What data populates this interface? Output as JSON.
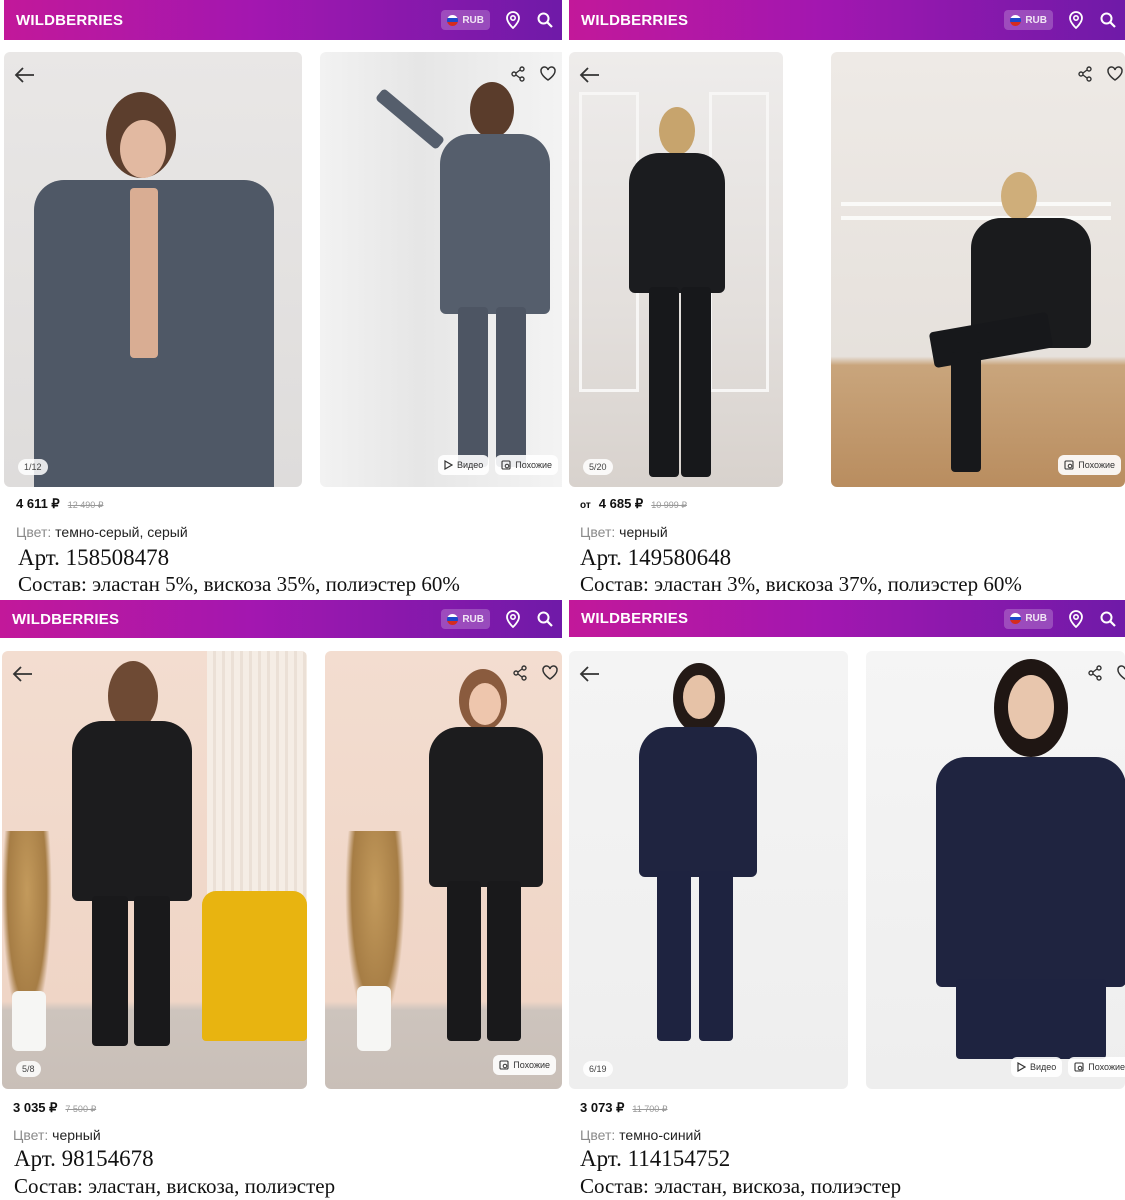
{
  "brand": "WILDBERRIES",
  "currency": "RUB",
  "labels": {
    "video": "Видео",
    "similar": "Похожие",
    "color_label": "Цвет:"
  },
  "colors": {
    "header_start": "#c2189a",
    "header_end": "#6f1aa8"
  },
  "products": [
    {
      "counter": "1/12",
      "price": "4 611 ₽",
      "old_price": "12 490 ₽",
      "price_prefix": "",
      "color": "темно-серый, серый",
      "article": "Арт. 158508478",
      "composition": "Состав: эластан 5%, вискоза 35%, полиэстер 60%",
      "has_video": true
    },
    {
      "counter": "5/20",
      "price": "4 685 ₽",
      "old_price": "10 999 ₽",
      "price_prefix": "от",
      "color": "черный",
      "article": "Арт. 149580648",
      "composition": "Состав: эластан 3%, вискоза 37%, полиэстер 60%",
      "has_video": false
    },
    {
      "counter": "5/8",
      "price": "3 035 ₽",
      "old_price": "7 500 ₽",
      "price_prefix": "",
      "color": "черный",
      "article": "Арт. 98154678",
      "composition": "Состав: эластан, вискоза, полиэстер",
      "has_video": false
    },
    {
      "counter": "6/19",
      "price": "3 073 ₽",
      "old_price": "11 700 ₽",
      "price_prefix": "",
      "color": "темно-синий",
      "article": "Арт. 114154752",
      "composition": "Состав: эластан, вискоза, полиэстер",
      "has_video": true
    }
  ]
}
